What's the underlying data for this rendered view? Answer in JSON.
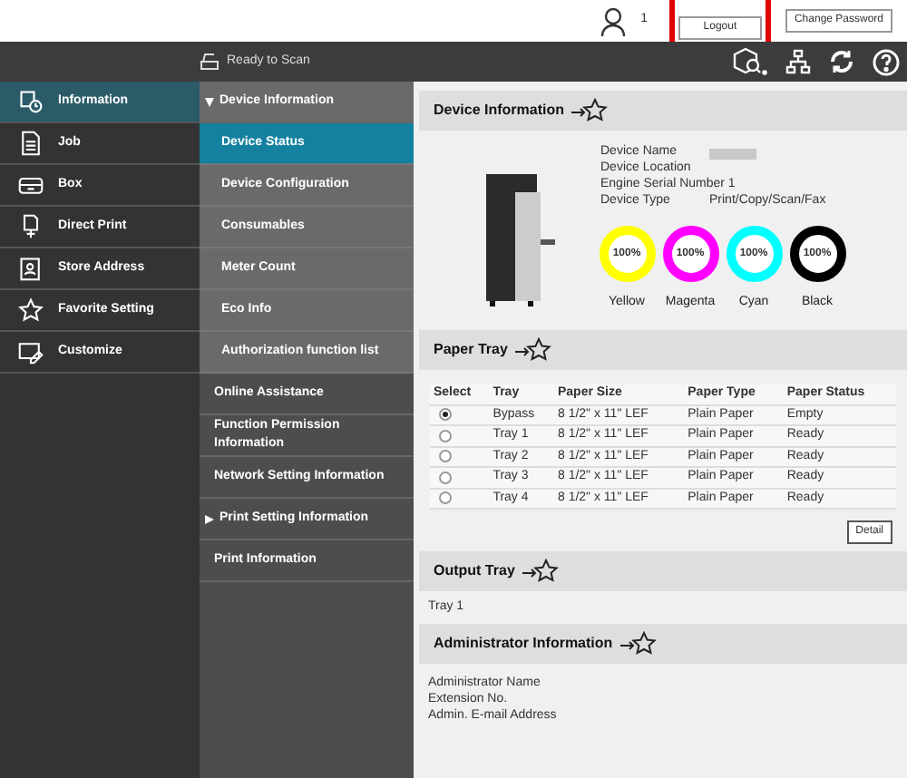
{
  "header": {
    "user_count": "1",
    "logout": {
      "label": "Logout",
      "highlighted": true
    },
    "change_password": "Change Password"
  },
  "toolbar": {
    "status": "Ready to Scan"
  },
  "nav": [
    {
      "label": "Information",
      "selected": true
    },
    {
      "label": "Job",
      "selected": false
    },
    {
      "label": "Box",
      "selected": false
    },
    {
      "label": "Direct Print",
      "selected": false
    },
    {
      "label": "Store Address",
      "selected": false
    },
    {
      "label": "Favorite Setting",
      "selected": false
    },
    {
      "label": "Customize",
      "selected": false
    }
  ],
  "submenu": [
    {
      "label": "Device Information",
      "expanded": true,
      "children": [
        {
          "label": "Device Status",
          "selected": true
        },
        {
          "label": "Device Configuration",
          "selected": false
        },
        {
          "label": "Consumables",
          "selected": false
        },
        {
          "label": "Meter Count",
          "selected": false
        },
        {
          "label": "Eco Info",
          "selected": false
        },
        {
          "label": "Authorization function list",
          "selected": false
        }
      ]
    },
    {
      "label": "Online Assistance"
    },
    {
      "label": "Function Permission Information"
    },
    {
      "label": "Network Setting Information"
    },
    {
      "label": "Print Setting Information",
      "expanded": false
    },
    {
      "label": "Print Information"
    }
  ],
  "device_info": {
    "title": "Device Information",
    "fields": [
      {
        "label": "Device Name",
        "blurred": true
      },
      {
        "label": "Device Location"
      },
      {
        "label": "Engine Serial Number 1"
      },
      {
        "label": "Device Type",
        "value": "Print/Copy/Scan/Fax"
      }
    ],
    "toner": [
      {
        "name": "Yellow",
        "color": "#ffff00",
        "reading": "100%"
      },
      {
        "name": "Magenta",
        "color": "#ff00ff",
        "reading": "100%"
      },
      {
        "name": "Cyan",
        "color": "#00ffff",
        "reading": "100%"
      },
      {
        "name": "Black",
        "color": "#000000",
        "reading": "100%"
      }
    ]
  },
  "paper_tray": {
    "title": "Paper Tray",
    "columns": [
      "Select",
      "Tray",
      "Paper Size",
      "Paper Type",
      "Paper Status"
    ],
    "rows": [
      {
        "selected": true,
        "cells": [
          "",
          "Bypass",
          "8 1/2\" x 11\" LEF",
          "Plain Paper",
          "Empty"
        ]
      },
      {
        "selected": false,
        "cells": [
          "",
          "Tray 1",
          "8 1/2\" x 11\" LEF",
          "Plain Paper",
          "Ready"
        ]
      },
      {
        "selected": false,
        "cells": [
          "",
          "Tray 2",
          "8 1/2\" x 11\" LEF",
          "Plain Paper",
          "Ready"
        ]
      },
      {
        "selected": false,
        "cells": [
          "",
          "Tray 3",
          "8 1/2\" x 11\" LEF",
          "Plain Paper",
          "Ready"
        ]
      },
      {
        "selected": false,
        "cells": [
          "",
          "Tray 4",
          "8 1/2\" x 11\" LEF",
          "Plain Paper",
          "Ready"
        ]
      }
    ],
    "detail_button": "Detail"
  },
  "output_tray": {
    "title": "Output Tray",
    "value": "Tray 1"
  },
  "admin": {
    "title": "Administrator Information",
    "fields": [
      "Administrator Name",
      "Extension No.",
      "Admin. E-mail Address"
    ]
  }
}
